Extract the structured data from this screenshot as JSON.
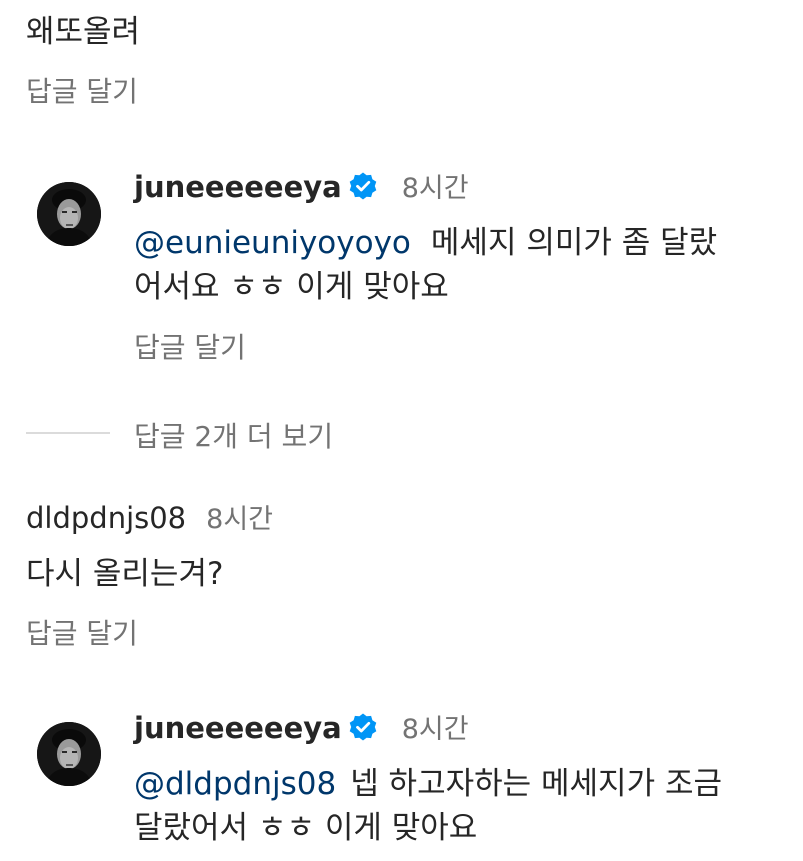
{
  "comments": [
    {
      "text": "왜또올려",
      "reply_label": "답글 달기"
    },
    {
      "username": "juneeeeeeya",
      "verified": true,
      "time": "8시간",
      "mention": "@eunieuniyoyoyo",
      "line1": "메세지 의미가 좀 달랐",
      "line2": "어서요 ㅎㅎ 이게 맞아요",
      "reply_label": "답글 달기"
    },
    {
      "more_replies_label": "답글 2개 더 보기"
    },
    {
      "username": "dldpdnjs08",
      "time": "8시간",
      "text": "다시 올리는겨?",
      "reply_label": "답글 달기"
    },
    {
      "username": "juneeeeeeya",
      "verified": true,
      "time": "8시간",
      "mention": "@dldpdnjs08",
      "line1": "넵 하고자하는 메세지가 조금",
      "line2": "달랐어서 ㅎㅎ 이게 맞아요"
    }
  ],
  "colors": {
    "text": "#262626",
    "secondary": "#737373",
    "mention": "#00376b",
    "verified_badge": "#0095f6",
    "divider": "#dbdbdb"
  }
}
